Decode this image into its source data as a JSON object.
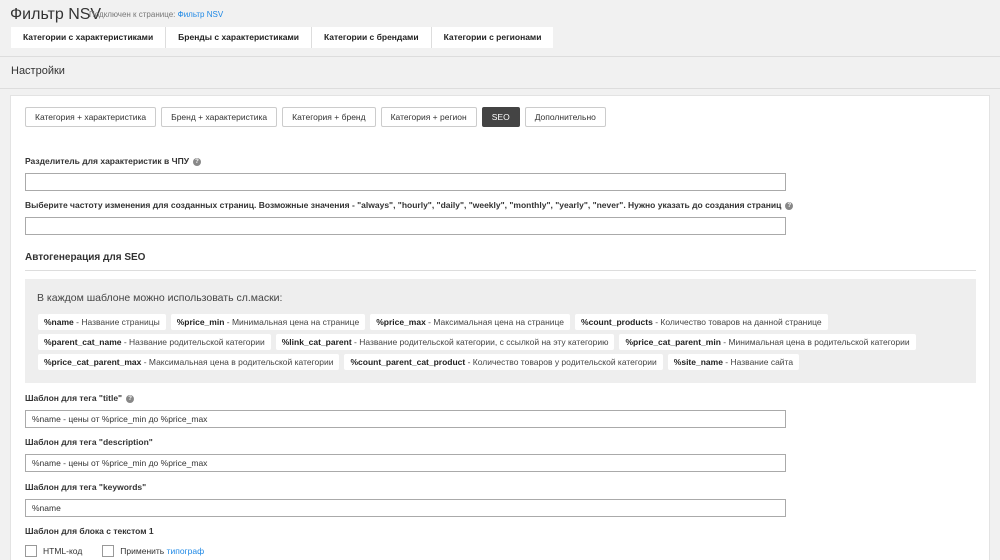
{
  "header": {
    "title": "Фильтр NSV",
    "connected_prefix": "Подключен к странице:",
    "connected_link": "Фильтр NSV",
    "tabs": [
      "Категории с характеристиками",
      "Бренды с характеристиками",
      "Категории с брендами",
      "Категории с регионами"
    ]
  },
  "settings_title": "Настройки",
  "subtabs": [
    "Категория + характеристика",
    "Бренд + характеристика",
    "Категория + бренд",
    "Категория + регион",
    "SEO",
    "Дополнительно"
  ],
  "active_subtab": "SEO",
  "fields": {
    "separator": {
      "label": "Разделитель для характеристик в ЧПУ",
      "value": ""
    },
    "frequency": {
      "label": "Выберите частоту изменения для созданных страниц. Возможные значения - \"always\", \"hourly\", \"daily\", \"weekly\", \"monthly\", \"yearly\", \"never\". Нужно указать до создания страниц",
      "value": ""
    },
    "title_tpl": {
      "label": "Шаблон для тега \"title\"",
      "value": "%name - цены от %price_min до %price_max"
    },
    "description_tpl": {
      "label": "Шаблон для тега \"description\"",
      "value": "%name - цены от %price_min до %price_max"
    },
    "keywords_tpl": {
      "label": "Шаблон для тега \"keywords\"",
      "value": "%name"
    },
    "text_block": {
      "label": "Шаблон для блока с текстом 1"
    }
  },
  "seo_section": {
    "title": "Автогенерация для SEO",
    "masks_title": "В каждом шаблоне можно использовать сл.маски:",
    "rows": [
      [
        {
          "key": "%name",
          "desc": " - Название страницы"
        },
        {
          "key": "%price_min",
          "desc": " - Минимальная цена на странице"
        },
        {
          "key": "%price_max",
          "desc": " - Максимальная цена на странице"
        },
        {
          "key": "%count_products",
          "desc": " - Количество товаров на данной странице"
        }
      ],
      [
        {
          "key": "%parent_cat_name",
          "desc": " - Название родительской категории"
        },
        {
          "key": "%link_cat_parent",
          "desc": " - Название родительской категории, с ссылкой на эту категорию"
        },
        {
          "key": "%price_cat_parent_min",
          "desc": " - Минимальная цена в родительской категории"
        }
      ],
      [
        {
          "key": "%price_cat_parent_max",
          "desc": " - Максимальная цена в родительской категории"
        },
        {
          "key": "%count_parent_cat_product",
          "desc": " - Количество товаров у родительской категории"
        },
        {
          "key": "%site_name",
          "desc": " - Название сайта"
        }
      ]
    ]
  },
  "checkboxes": {
    "html": "HTML-код",
    "apply_prefix": "Применить ",
    "apply_link": "типограф"
  },
  "icons": {
    "help": "question-circle-icon"
  }
}
